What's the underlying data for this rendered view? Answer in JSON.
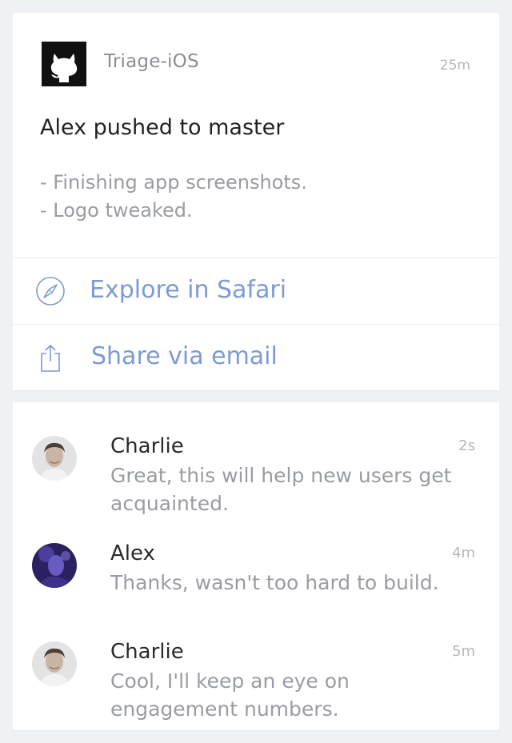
{
  "notification": {
    "repo_name": "Triage-iOS",
    "time": "25m",
    "repo_icon": "github-octocat-icon",
    "headline": "Alex pushed to master",
    "commit_lines": [
      "- Finishing app screenshots.",
      "- Logo tweaked."
    ],
    "actions": [
      {
        "icon": "compass-icon",
        "label": "Explore in Safari"
      },
      {
        "icon": "share-icon",
        "label": "Share via email"
      }
    ]
  },
  "comments": [
    {
      "author": "Charlie",
      "time": "2s",
      "text": "Great, this will help new users get acquainted."
    },
    {
      "author": "Alex",
      "time": "4m",
      "text": "Thanks, wasn't too hard to build."
    },
    {
      "author": "Charlie",
      "time": "5m",
      "text": "Cool, I'll keep an eye on engagement numbers."
    }
  ],
  "colors": {
    "background": "#f0f1f5",
    "card": "#ffffff",
    "action_link": "#7d9bd3",
    "secondary_text": "#9a9ca3",
    "timestamp": "#b4b6bd"
  }
}
